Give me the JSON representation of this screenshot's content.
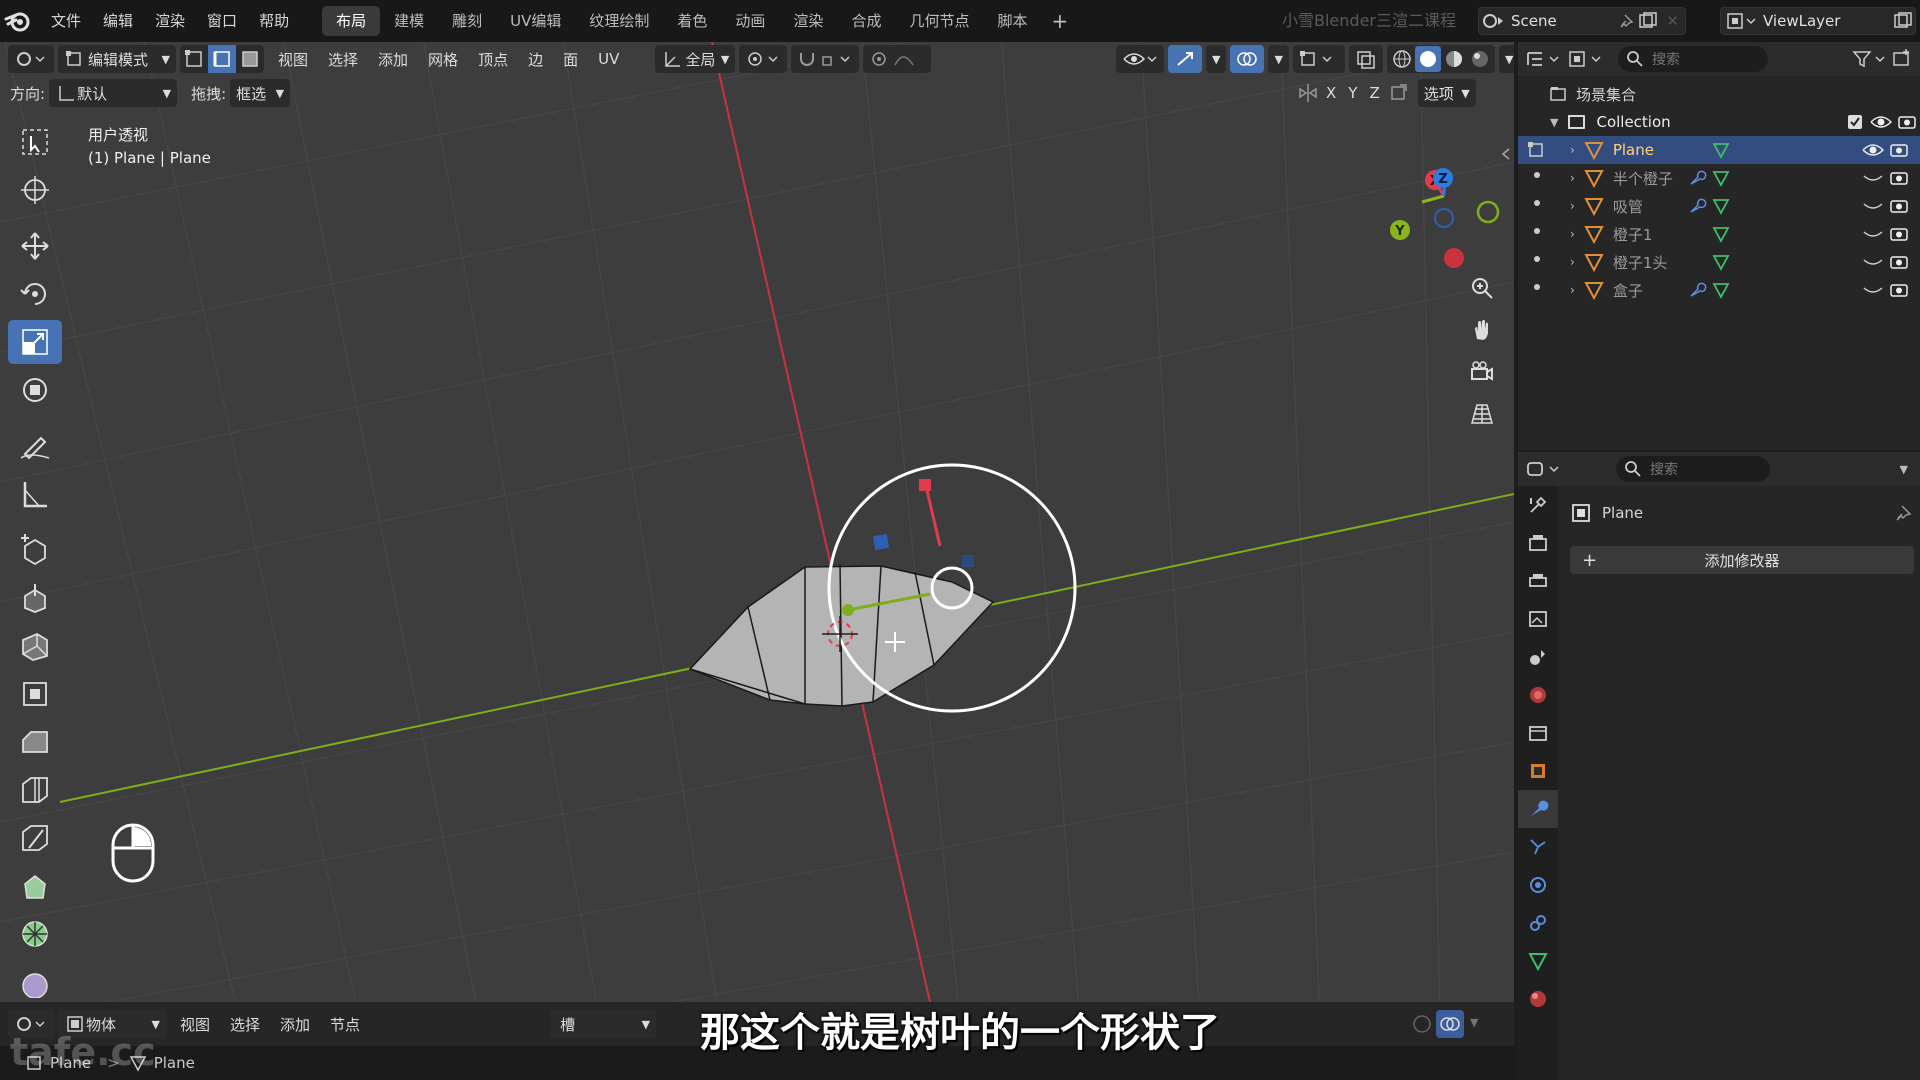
{
  "topbar": {
    "menus": [
      "文件",
      "编辑",
      "渲染",
      "窗口",
      "帮助"
    ],
    "workspaces": [
      "布局",
      "建模",
      "雕刻",
      "UV编辑",
      "纹理绘制",
      "着色",
      "动画",
      "渲染",
      "合成",
      "几何节点",
      "脚本"
    ],
    "active_workspace": "布局",
    "course_title": "小雪Blender三渲二课程",
    "scene": "Scene",
    "view_layer": "ViewLayer"
  },
  "viewport_header": {
    "mode": "编辑模式",
    "menus": [
      "视图",
      "选择",
      "添加",
      "网格",
      "顶点",
      "边",
      "面",
      "UV"
    ],
    "transform_orientation": "全局",
    "orientation_label": "方向:",
    "orientation_value": "默认",
    "drag_label": "拖拽:",
    "drag_value": "框选",
    "axes": [
      "X",
      "Y",
      "Z"
    ],
    "options_label": "选项"
  },
  "viewport_overlay": {
    "view_name": "用户透视",
    "object_info": "(1) Plane | Plane"
  },
  "gizmo": {
    "x": "X",
    "y": "Y",
    "z": "Z"
  },
  "timeline": {
    "editor": "物体",
    "menus": [
      "视图",
      "选择",
      "添加",
      "节点"
    ],
    "slot": "槽"
  },
  "statusbar": {
    "items": [
      "Plane",
      "Plane"
    ]
  },
  "subtitle": "那这个就是树叶的一个形状了",
  "watermark": "tafe.cc",
  "outliner": {
    "search_placeholder": "搜索",
    "scene_collection": "场景集合",
    "collection": "Collection",
    "objects": [
      {
        "name": "Plane",
        "selected": true,
        "has_modifier": false
      },
      {
        "name": "半个橙子",
        "selected": false,
        "has_modifier": true
      },
      {
        "name": "吸管",
        "selected": false,
        "has_modifier": true
      },
      {
        "name": "橙子1",
        "selected": false,
        "has_modifier": false
      },
      {
        "name": "橙子1头",
        "selected": false,
        "has_modifier": false
      },
      {
        "name": "盒子",
        "selected": false,
        "has_modifier": true
      }
    ]
  },
  "properties": {
    "search_placeholder": "搜索",
    "object_name": "Plane",
    "add_modifier": "添加修改器"
  },
  "colors": {
    "accent": "#4772b3",
    "x_axis": "#e03c4d",
    "y_axis": "#8ab51f",
    "z_axis": "#2f7ce0",
    "selected_text": "#ffd27a"
  }
}
